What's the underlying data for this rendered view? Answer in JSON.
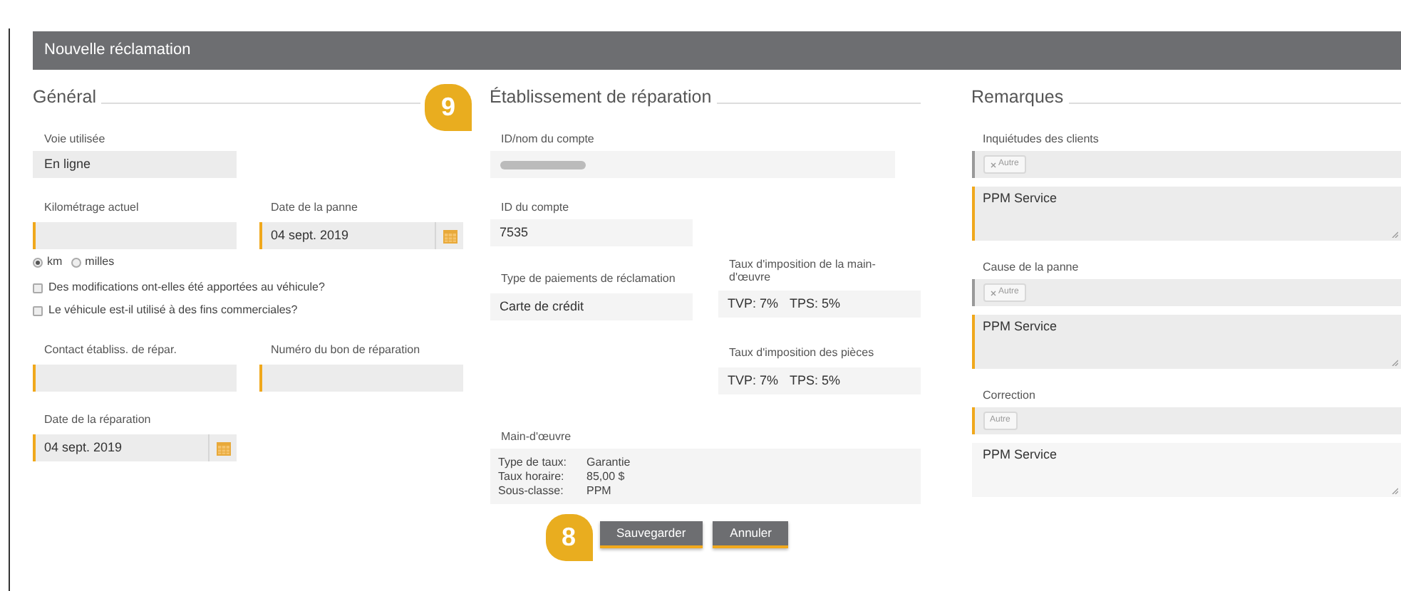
{
  "title": "Nouvelle réclamation",
  "section_badge": "9",
  "button_badge": "8",
  "general": {
    "title": "Général",
    "channel": {
      "label": "Voie utilisée",
      "value": "En ligne"
    },
    "mileage": {
      "label": "Kilométrage actuel",
      "required": true
    },
    "failure_date": {
      "label": "Date de la panne",
      "value": "04 sept. 2019",
      "required": true
    },
    "units": [
      {
        "label": "km",
        "selected": true
      },
      {
        "label": "milles",
        "selected": false
      }
    ],
    "questions": [
      {
        "label": "Des modifications ont-elles été apportées au véhicule?",
        "checked": false
      },
      {
        "label": "Le véhicule est-il utilisé à des fins commerciales?",
        "checked": false
      }
    ],
    "contact": {
      "label": "Contact établiss. de répar.",
      "required": true
    },
    "repair_order": {
      "label": "Numéro du bon de réparation",
      "required": true
    },
    "repair_date": {
      "label": "Date de la réparation",
      "value": "04 sept. 2019",
      "required": true
    }
  },
  "shop": {
    "title": "Établissement de réparation",
    "account_name": {
      "label": "ID/nom du compte"
    },
    "account_id": {
      "label": "ID du compte",
      "value": "7535"
    },
    "payment_type": {
      "label": "Type de paiements de réclamation",
      "value": "Carte de crédit"
    },
    "labour_tax": {
      "label": "Taux d'imposition de la main-d'œuvre",
      "values": [
        "TVP: 7%",
        "TPS: 5%"
      ]
    },
    "parts_tax": {
      "label": "Taux d'imposition des pièces",
      "values": [
        "TVP: 7%",
        "TPS: 5%"
      ]
    },
    "labour": {
      "label": "Main-d'œuvre",
      "rows": [
        {
          "name": "Type de taux:",
          "value": "Garantie"
        },
        {
          "name": "Taux horaire:",
          "value": "85,00 $"
        },
        {
          "name": "Sous-classe:",
          "value": "PPM"
        }
      ]
    }
  },
  "remarks": {
    "title": "Remarques",
    "groups": [
      {
        "label": "Inquiétudes des clients",
        "tag": "Autre",
        "removable": true,
        "required": false,
        "text": "PPM Service",
        "text_required": true
      },
      {
        "label": "Cause de la panne",
        "tag": "Autre",
        "removable": true,
        "required": false,
        "text": "PPM Service",
        "text_required": true
      },
      {
        "label": "Correction",
        "tag": "Autre",
        "removable": false,
        "required": true,
        "text": "PPM Service",
        "text_required": false
      }
    ]
  },
  "buttons": [
    {
      "label": "Sauvegarder"
    },
    {
      "label": "Annuler"
    }
  ]
}
